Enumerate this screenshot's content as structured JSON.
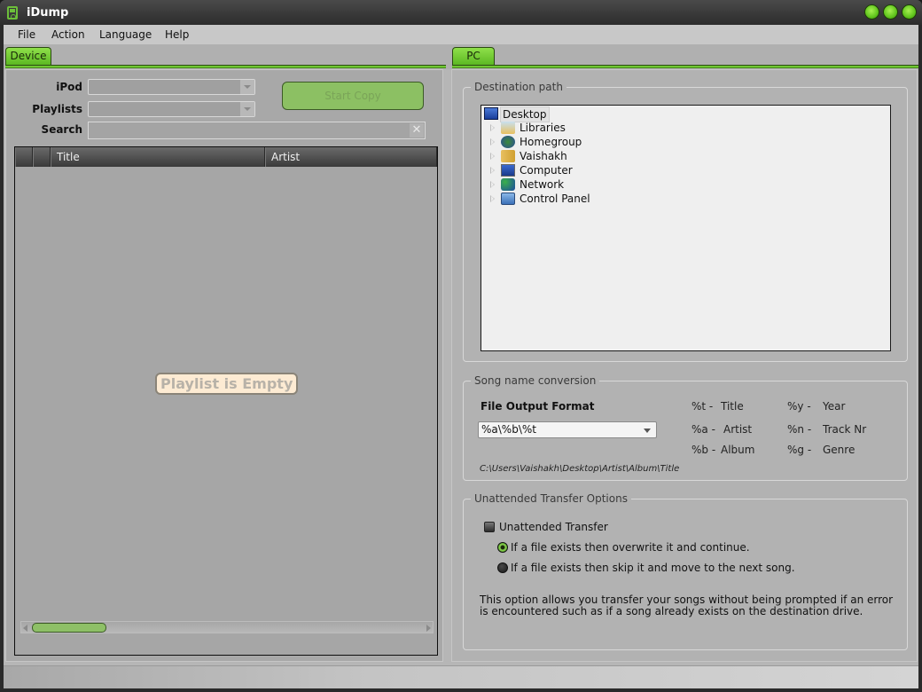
{
  "window": {
    "title": "iDump",
    "controls": [
      "minimize",
      "maximize",
      "close"
    ]
  },
  "menu": [
    "File",
    "Action",
    "Language",
    "Help"
  ],
  "device_panel": {
    "tab_label": "Device",
    "ipod_label": "iPod",
    "ipod_value": "",
    "playlists_label": "Playlists",
    "playlists_value": "",
    "search_label": "Search",
    "search_value": "",
    "search_clear_icon": "✕",
    "start_copy_label": "Start Copy",
    "columns": [
      "",
      "",
      "Title",
      "Artist"
    ],
    "empty_message": "Playlist is Empty"
  },
  "pc_panel": {
    "tab_label": "PC",
    "destination": {
      "group_title": "Destination path",
      "tree": [
        {
          "label": "Desktop",
          "icon": "desktop-icon",
          "selected": true,
          "expandable": false
        },
        {
          "label": "Libraries",
          "icon": "libraries-icon",
          "expandable": true
        },
        {
          "label": "Homegroup",
          "icon": "homegroup-icon",
          "expandable": true
        },
        {
          "label": "Vaishakh",
          "icon": "user-folder-icon",
          "expandable": true
        },
        {
          "label": "Computer",
          "icon": "computer-icon",
          "expandable": true
        },
        {
          "label": "Network",
          "icon": "network-icon",
          "expandable": true
        },
        {
          "label": "Control Panel",
          "icon": "control-panel-icon",
          "expandable": true
        }
      ]
    },
    "conversion": {
      "group_title": "Song name conversion",
      "format_label": "File Output Format",
      "format_value": "%a\\%b\\%t",
      "example_path": "C:\\Users\\Vaishakh\\Desktop\\Artist\\Album\\Title",
      "legend": [
        {
          "code": "%t -",
          "meaning": "Title"
        },
        {
          "code": "%a -",
          "meaning": "Artist"
        },
        {
          "code": "%b -",
          "meaning": "Album"
        },
        {
          "code": "%y -",
          "meaning": "Year"
        },
        {
          "code": "%n -",
          "meaning": "Track Nr"
        },
        {
          "code": "%g -",
          "meaning": "Genre"
        }
      ]
    },
    "unattended": {
      "group_title": "Unattended Transfer Options",
      "checkbox_label": "Unattended Transfer",
      "checkbox_checked": false,
      "options": [
        {
          "label": "If a file exists then overwrite it and continue.",
          "selected": true
        },
        {
          "label": "If a file exists then skip it and move to the next song.",
          "selected": false
        }
      ],
      "description": "This option allows you transfer your songs without being prompted if an error is encountered such as if a song already exists on the destination drive."
    }
  },
  "colors": {
    "accent_green": "#6ec632",
    "panel_gray": "#a8a8a8",
    "titlebar_dark": "#2c2c2c"
  }
}
